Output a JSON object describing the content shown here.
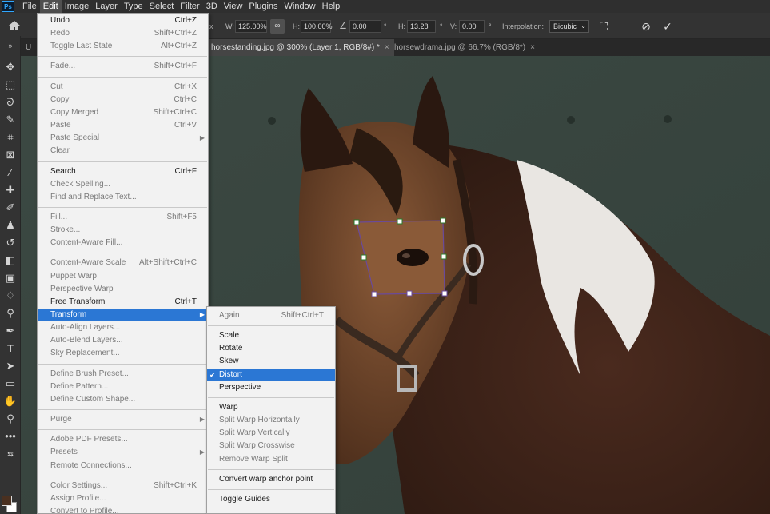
{
  "menubar": {
    "logo": "Ps",
    "items": [
      "File",
      "Edit",
      "Image",
      "Layer",
      "Type",
      "Select",
      "Filter",
      "3D",
      "View",
      "Plugins",
      "Window",
      "Help"
    ],
    "active": "Edit"
  },
  "options": {
    "x_suffix": "x",
    "w_label": "W:",
    "w_value": "125.00%",
    "link_icon": "link-icon",
    "h_label": "H:",
    "h_value": "100.00%",
    "angle_value": "0.00",
    "angle_unit": "°",
    "hskew_label": "H:",
    "hskew_value": "13.28",
    "hskew_unit": "°",
    "vskew_label": "V:",
    "vskew_value": "0.00",
    "vskew_unit": "°",
    "interp_label": "Interpolation:",
    "interp_value": "Bicubic"
  },
  "tabs": [
    {
      "label": "horsestanding.jpg @ 300% (Layer 1, RGB/8#) *",
      "active": true
    },
    {
      "label": "horsewdrama.jpg @ 66.7% (RGB/8*)",
      "active": false
    }
  ],
  "tab_close": "×",
  "edit_menu": {
    "items": [
      {
        "label": "Undo",
        "shortcut": "Ctrl+Z",
        "disabled": false
      },
      {
        "label": "Redo",
        "shortcut": "Shift+Ctrl+Z",
        "disabled": true
      },
      {
        "label": "Toggle Last State",
        "shortcut": "Alt+Ctrl+Z",
        "disabled": true
      },
      {
        "sep": true
      },
      {
        "label": "Fade...",
        "shortcut": "Shift+Ctrl+F",
        "disabled": true
      },
      {
        "sep": true
      },
      {
        "label": "Cut",
        "shortcut": "Ctrl+X",
        "disabled": true
      },
      {
        "label": "Copy",
        "shortcut": "Ctrl+C",
        "disabled": true
      },
      {
        "label": "Copy Merged",
        "shortcut": "Shift+Ctrl+C",
        "disabled": true
      },
      {
        "label": "Paste",
        "shortcut": "Ctrl+V",
        "disabled": true
      },
      {
        "label": "Paste Special",
        "shortcut": "",
        "disabled": true,
        "submenu": true
      },
      {
        "label": "Clear",
        "shortcut": "",
        "disabled": true
      },
      {
        "sep": true
      },
      {
        "label": "Search",
        "shortcut": "Ctrl+F",
        "disabled": false
      },
      {
        "label": "Check Spelling...",
        "shortcut": "",
        "disabled": true
      },
      {
        "label": "Find and Replace Text...",
        "shortcut": "",
        "disabled": true
      },
      {
        "sep": true
      },
      {
        "label": "Fill...",
        "shortcut": "Shift+F5",
        "disabled": true
      },
      {
        "label": "Stroke...",
        "shortcut": "",
        "disabled": true
      },
      {
        "label": "Content-Aware Fill...",
        "shortcut": "",
        "disabled": true
      },
      {
        "sep": true
      },
      {
        "label": "Content-Aware Scale",
        "shortcut": "Alt+Shift+Ctrl+C",
        "disabled": true
      },
      {
        "label": "Puppet Warp",
        "shortcut": "",
        "disabled": true
      },
      {
        "label": "Perspective Warp",
        "shortcut": "",
        "disabled": true
      },
      {
        "label": "Free Transform",
        "shortcut": "Ctrl+T",
        "disabled": false
      },
      {
        "label": "Transform",
        "shortcut": "",
        "disabled": false,
        "submenu": true,
        "highlight": true
      },
      {
        "label": "Auto-Align Layers...",
        "shortcut": "",
        "disabled": true
      },
      {
        "label": "Auto-Blend Layers...",
        "shortcut": "",
        "disabled": true
      },
      {
        "label": "Sky Replacement...",
        "shortcut": "",
        "disabled": true
      },
      {
        "sep": true
      },
      {
        "label": "Define Brush Preset...",
        "shortcut": "",
        "disabled": true
      },
      {
        "label": "Define Pattern...",
        "shortcut": "",
        "disabled": true
      },
      {
        "label": "Define Custom Shape...",
        "shortcut": "",
        "disabled": true
      },
      {
        "sep": true
      },
      {
        "label": "Purge",
        "shortcut": "",
        "disabled": true,
        "submenu": true
      },
      {
        "sep": true
      },
      {
        "label": "Adobe PDF Presets...",
        "shortcut": "",
        "disabled": true
      },
      {
        "label": "Presets",
        "shortcut": "",
        "disabled": true,
        "submenu": true
      },
      {
        "label": "Remote Connections...",
        "shortcut": "",
        "disabled": true
      },
      {
        "sep": true
      },
      {
        "label": "Color Settings...",
        "shortcut": "Shift+Ctrl+K",
        "disabled": true
      },
      {
        "label": "Assign Profile...",
        "shortcut": "",
        "disabled": true
      },
      {
        "label": "Convert to Profile...",
        "shortcut": "",
        "disabled": true
      }
    ]
  },
  "transform_menu": {
    "items": [
      {
        "label": "Again",
        "shortcut": "Shift+Ctrl+T",
        "disabled": true
      },
      {
        "sep": true
      },
      {
        "label": "Scale",
        "shortcut": "",
        "disabled": false
      },
      {
        "label": "Rotate",
        "shortcut": "",
        "disabled": false
      },
      {
        "label": "Skew",
        "shortcut": "",
        "disabled": false
      },
      {
        "label": "Distort",
        "shortcut": "",
        "disabled": false,
        "highlight": true,
        "checked": true
      },
      {
        "label": "Perspective",
        "shortcut": "",
        "disabled": false
      },
      {
        "sep": true
      },
      {
        "label": "Warp",
        "shortcut": "",
        "disabled": false
      },
      {
        "label": "Split Warp Horizontally",
        "shortcut": "",
        "disabled": true
      },
      {
        "label": "Split Warp Vertically",
        "shortcut": "",
        "disabled": true
      },
      {
        "label": "Split Warp Crosswise",
        "shortcut": "",
        "disabled": true
      },
      {
        "label": "Remove Warp Split",
        "shortcut": "",
        "disabled": true
      },
      {
        "sep": true
      },
      {
        "label": "Convert warp anchor point",
        "shortcut": "",
        "disabled": false
      },
      {
        "sep": true
      },
      {
        "label": "Toggle Guides",
        "shortcut": "",
        "disabled": false
      }
    ]
  },
  "colors": {
    "accent": "#2b77d4",
    "foreground_swatch": "#4a3020",
    "background_swatch": "#ffffff"
  }
}
